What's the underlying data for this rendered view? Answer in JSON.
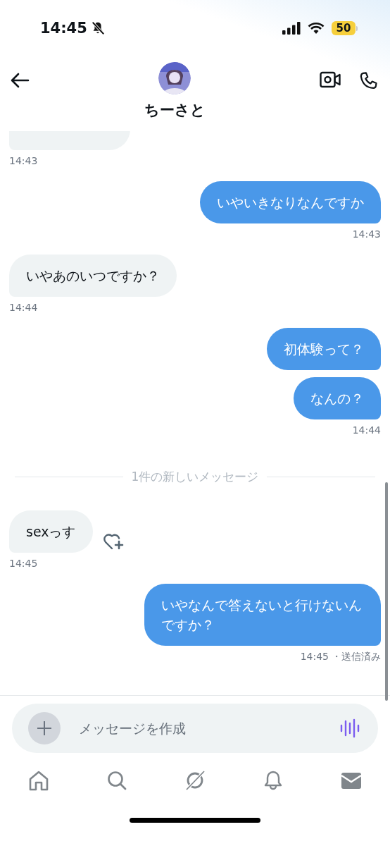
{
  "status_bar": {
    "time": "14:45",
    "silent": true,
    "battery": "50",
    "low_power": true
  },
  "conversation": {
    "name": "ちーさと"
  },
  "messages": [
    {
      "kind": "message",
      "sent": false,
      "time": "14:43"
    },
    {
      "kind": "message",
      "sent": true,
      "text": "いやいきなりなんですか",
      "time": "14:43"
    },
    {
      "kind": "message",
      "sent": false,
      "text": "いやあのいつですか？",
      "time": "14:44"
    },
    {
      "kind": "message",
      "sent": true,
      "text": "初体験って？"
    },
    {
      "kind": "message",
      "sent": true,
      "text": "なんの？",
      "time": "14:44"
    },
    {
      "kind": "divider",
      "text": "1件の新しいメッセージ"
    },
    {
      "kind": "message",
      "sent": false,
      "text": "sexっす",
      "time": "14:45",
      "reaction_button": true
    },
    {
      "kind": "message",
      "sent": true,
      "text": "いやなんで答えないと行けないんですか？",
      "time": "14:45",
      "status": "・送信済み"
    }
  ],
  "composer": {
    "placeholder": "メッセージを作成"
  },
  "nav": [
    {
      "kind": "home",
      "selected": false
    },
    {
      "kind": "search",
      "selected": false
    },
    {
      "kind": "grok",
      "selected": false
    },
    {
      "kind": "bell",
      "selected": false
    },
    {
      "kind": "mail",
      "selected": true
    }
  ]
}
